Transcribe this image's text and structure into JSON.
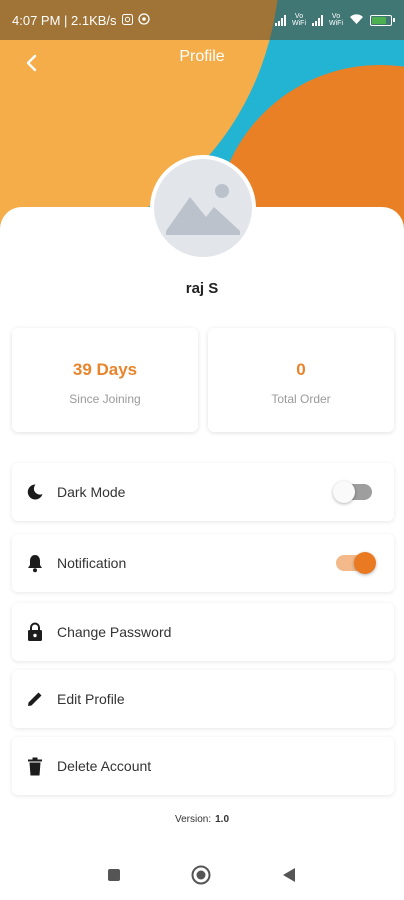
{
  "status_bar": {
    "time_speed": "4:07 PM | 2.1KB/s",
    "volte_label": "Vo\nWiFi",
    "icons": [
      "photo-notification-icon",
      "sync-notification-icon",
      "signal-icon",
      "wifi-icon",
      "battery-charging-icon"
    ]
  },
  "header": {
    "title": "Profile",
    "back_icon": "chevron-left-icon",
    "colors": {
      "teal": "#23b3d3",
      "yellow": "#f4ad48",
      "orange": "#ea8025"
    }
  },
  "profile": {
    "avatar_icon": "image-placeholder-icon",
    "name": "raj S"
  },
  "stats": [
    {
      "value": "39 Days",
      "label": "Since Joining"
    },
    {
      "value": "0",
      "label": "Total Order"
    }
  ],
  "menu": {
    "dark_mode": {
      "label": "Dark Mode",
      "icon": "moon-icon",
      "enabled": false
    },
    "notification": {
      "label": "Notification",
      "icon": "bell-icon",
      "enabled": true
    },
    "change_password": {
      "label": "Change Password",
      "icon": "lock-icon"
    },
    "edit_profile": {
      "label": "Edit Profile",
      "icon": "pencil-icon"
    },
    "delete_account": {
      "label": "Delete Account",
      "icon": "trash-icon"
    }
  },
  "version": {
    "label": "Version:",
    "value": "1.0"
  },
  "accent_color": "#e8842c",
  "system_nav": {
    "icons": [
      "recents-square-icon",
      "home-circle-icon",
      "back-triangle-icon"
    ]
  }
}
